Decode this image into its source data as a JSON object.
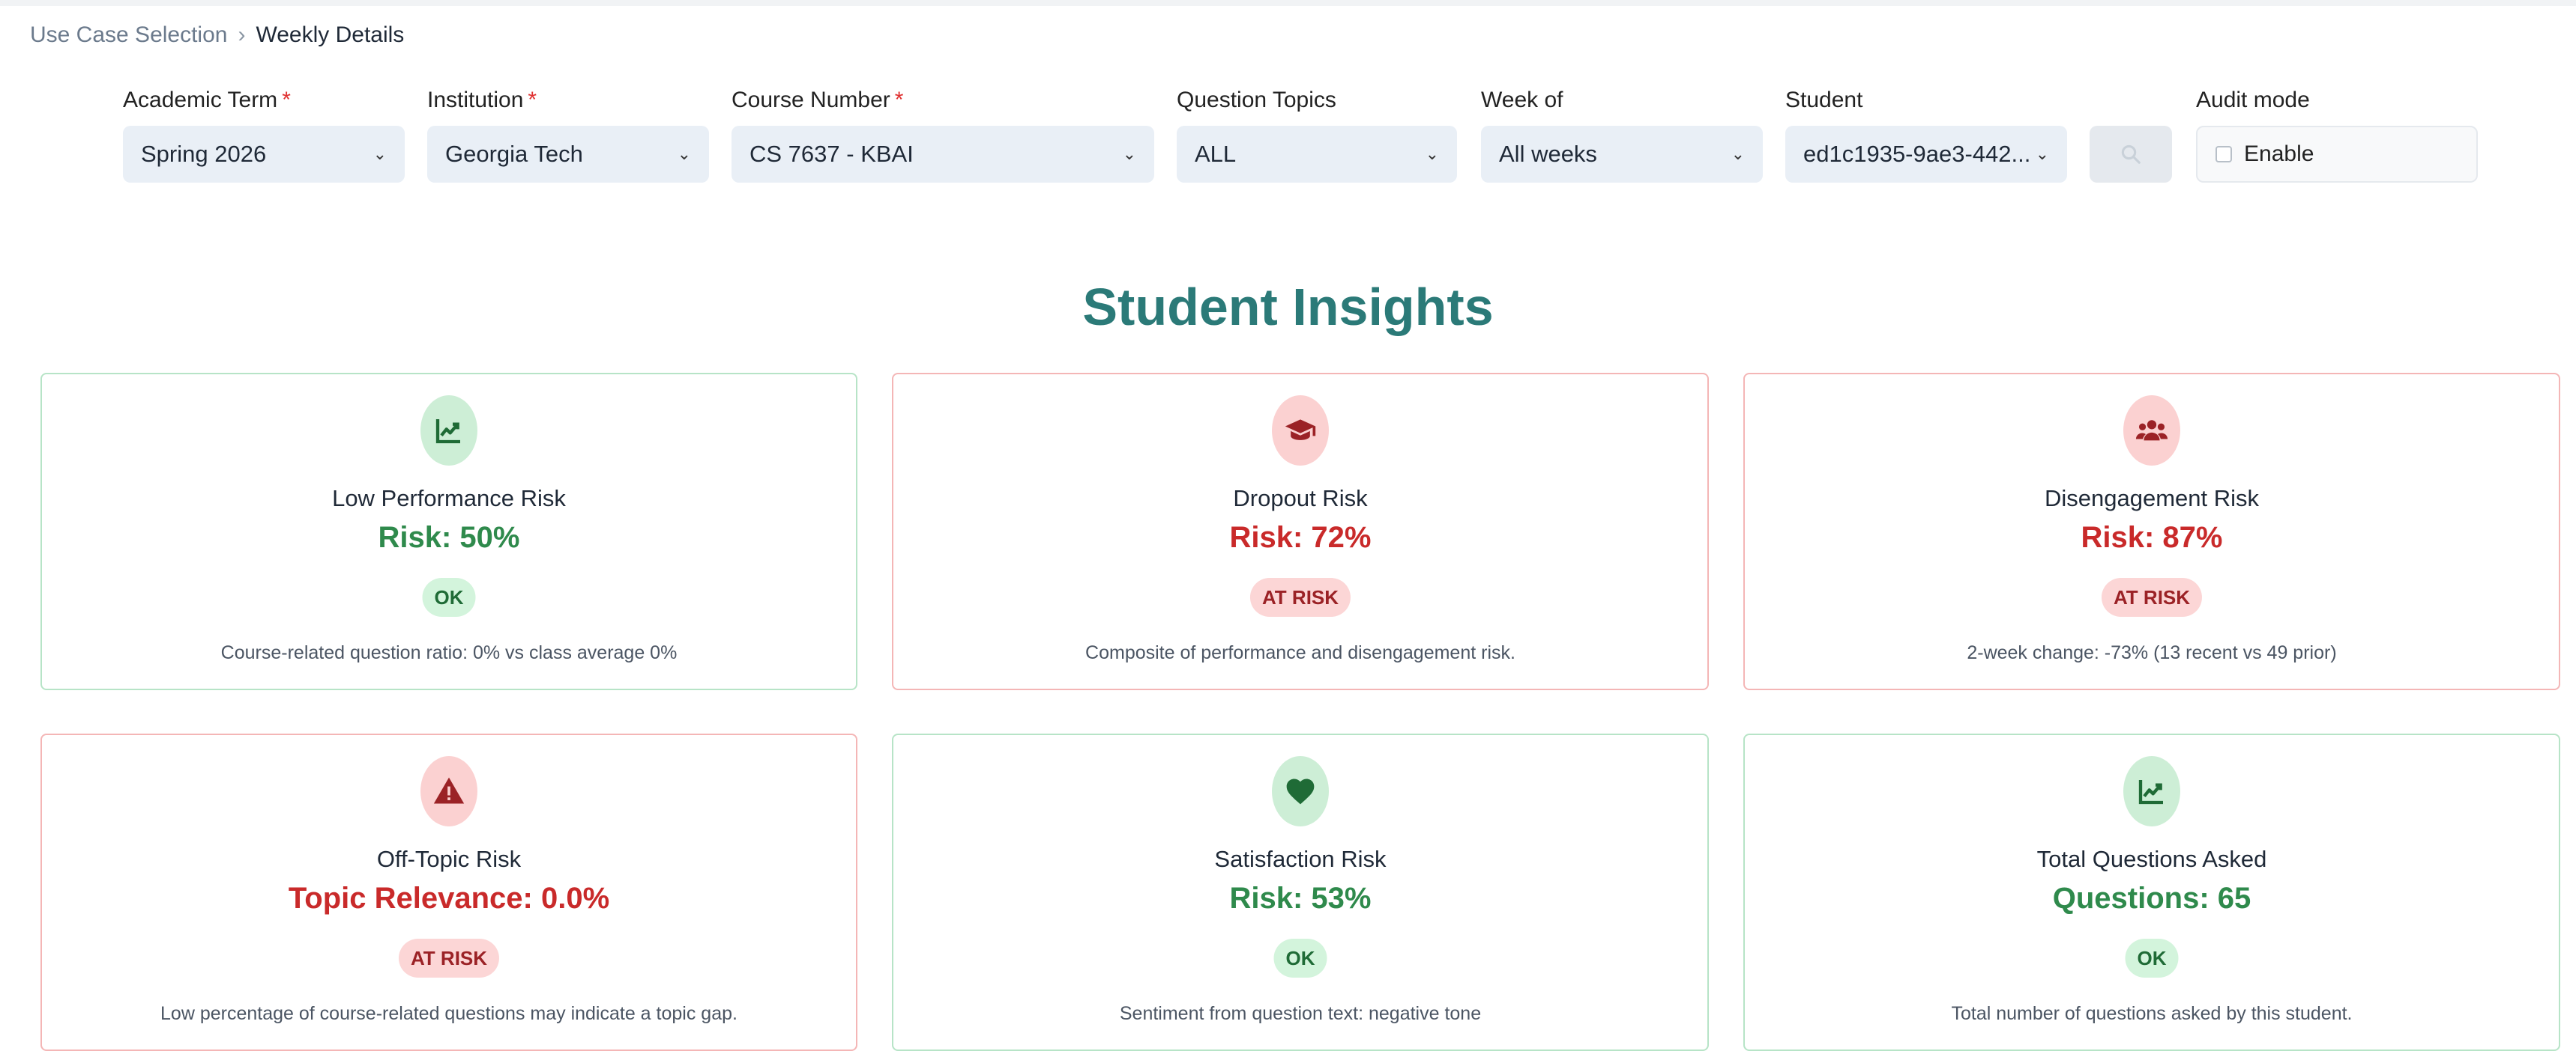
{
  "breadcrumb": {
    "parent": "Use Case Selection",
    "separator": "›",
    "current": "Weekly Details"
  },
  "filters": {
    "academic_term": {
      "label": "Academic Term",
      "required": "*",
      "value": "Spring 2026"
    },
    "institution": {
      "label": "Institution",
      "required": "*",
      "value": "Georgia Tech"
    },
    "course_number": {
      "label": "Course Number",
      "required": "*",
      "value": "CS 7637 - KBAI"
    },
    "question_topics": {
      "label": "Question Topics",
      "value": "ALL"
    },
    "week_of": {
      "label": "Week of",
      "value": "All weeks"
    },
    "student": {
      "label": "Student",
      "value": "ed1c1935-9ae3-442..."
    },
    "audit_mode": {
      "label": "Audit mode",
      "checkbox_label": "Enable"
    }
  },
  "page_title": "Student Insights",
  "cards": [
    {
      "title": "Low Performance Risk",
      "value": "Risk: 50%",
      "status": "OK",
      "description": "Course-related question ratio: 0% vs class average 0%",
      "icon": "chart-line-icon"
    },
    {
      "title": "Dropout Risk",
      "value": "Risk: 72%",
      "status": "AT RISK",
      "description": "Composite of performance and disengagement risk.",
      "icon": "graduation-cap-icon"
    },
    {
      "title": "Disengagement Risk",
      "value": "Risk: 87%",
      "status": "AT RISK",
      "description": "2-week change: -73% (13 recent vs 49 prior)",
      "icon": "users-icon"
    },
    {
      "title": "Off-Topic Risk",
      "value": "Topic Relevance: 0.0%",
      "status": "AT RISK",
      "description": "Low percentage of course-related questions may indicate a topic gap.",
      "icon": "warning-triangle-icon"
    },
    {
      "title": "Satisfaction Risk",
      "value": "Risk: 53%",
      "status": "OK",
      "description": "Sentiment from question text: negative tone",
      "icon": "heart-icon"
    },
    {
      "title": "Total Questions Asked",
      "value": "Questions: 65",
      "status": "OK",
      "description": "Total number of questions asked by this student.",
      "icon": "chart-line-icon"
    }
  ],
  "colors": {
    "title": "#2b7a78",
    "ok_text": "#2f8a4c",
    "risk_text": "#c92a2a",
    "ok_border": "#b7e4c7",
    "risk_border": "#f4b6b6"
  }
}
